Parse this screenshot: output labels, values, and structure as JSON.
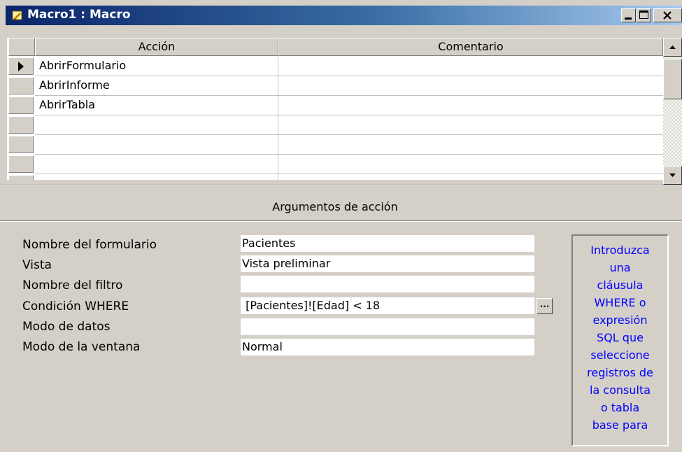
{
  "window": {
    "title": "Macro1 : Macro",
    "controls": {
      "minimize": "minimize-icon",
      "maximize": "maximize-icon",
      "close": "close-icon"
    }
  },
  "grid": {
    "columns": [
      "Acción",
      "Comentario"
    ],
    "rows": [
      {
        "accion": "AbrirFormulario",
        "comentario": ""
      },
      {
        "accion": "AbrirInforme",
        "comentario": ""
      },
      {
        "accion": "AbrirTabla",
        "comentario": ""
      },
      {
        "accion": "",
        "comentario": ""
      },
      {
        "accion": "",
        "comentario": ""
      },
      {
        "accion": "",
        "comentario": ""
      },
      {
        "accion": "",
        "comentario": ""
      }
    ],
    "selected_row_indicator": "current-row-arrow-icon"
  },
  "arguments": {
    "section_title": "Argumentos de acción",
    "fields": [
      {
        "label": "Nombre del formulario",
        "value": "Pacientes"
      },
      {
        "label": "Vista",
        "value": "Vista preliminar"
      },
      {
        "label": "Nombre del filtro",
        "value": ""
      },
      {
        "label": "Condición WHERE",
        "value": " [Pacientes]![Edad] < 18"
      },
      {
        "label": "Modo de datos",
        "value": ""
      },
      {
        "label": "Modo de la ventana",
        "value": "Normal"
      }
    ],
    "builder_button_label": "..."
  },
  "help": {
    "lines": [
      "Introduzca",
      "una",
      "cláusula",
      "WHERE o",
      "expresión",
      "SQL que",
      "seleccione",
      "registros de",
      "la consulta",
      "o tabla",
      "base para"
    ]
  },
  "colors": {
    "title_bar_start": "#0a246a",
    "title_bar_end": "#a6caf0",
    "face": "#d4d0c8",
    "help_text": "#0000ff"
  }
}
